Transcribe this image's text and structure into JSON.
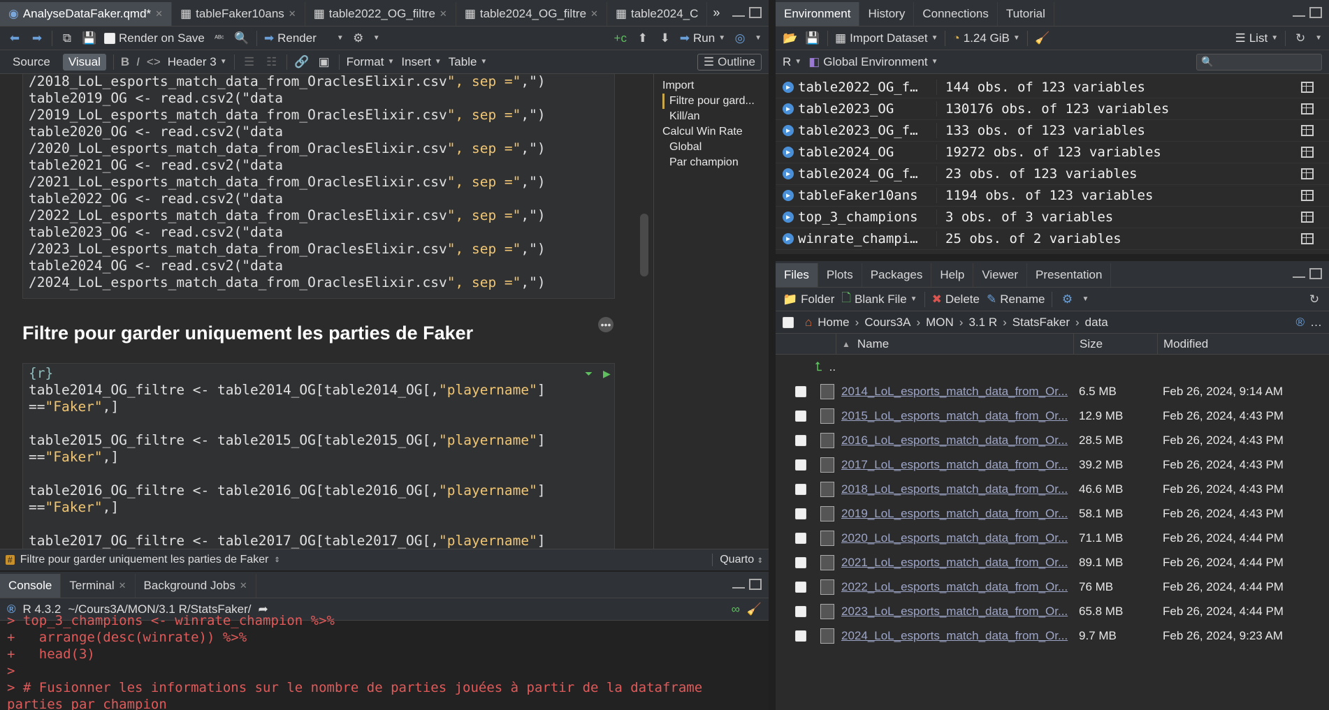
{
  "editor": {
    "tabs": [
      {
        "label": "AnalyseDataFaker.qmd*"
      },
      {
        "label": "tableFaker10ans"
      },
      {
        "label": "table2022_OG_filtre"
      },
      {
        "label": "table2024_OG_filtre"
      },
      {
        "label": "table2024_C"
      }
    ],
    "toolbar": {
      "render_on_save": "Render on Save",
      "render": "Render",
      "run": "Run"
    },
    "format_bar": {
      "source": "Source",
      "visual": "Visual",
      "bold": "B",
      "italic": "I",
      "code": "<>",
      "header": "Header 3",
      "format": "Format",
      "insert": "Insert",
      "table": "Table",
      "outline": "Outline"
    },
    "import_chunk_lines": [
      "/2018_LoL_esports_match_data_from_OraclesElixir.csv\", sep =\",\")",
      "table2019_OG <- read.csv2(\"data",
      "/2019_LoL_esports_match_data_from_OraclesElixir.csv\", sep =\",\")",
      "table2020_OG <- read.csv2(\"data",
      "/2020_LoL_esports_match_data_from_OraclesElixir.csv\", sep =\",\")",
      "table2021_OG <- read.csv2(\"data",
      "/2021_LoL_esports_match_data_from_OraclesElixir.csv\", sep =\",\")",
      "table2022_OG <- read.csv2(\"data",
      "/2022_LoL_esports_match_data_from_OraclesElixir.csv\", sep =\",\")",
      "table2023_OG <- read.csv2(\"data",
      "/2023_LoL_esports_match_data_from_OraclesElixir.csv\", sep =\",\")",
      "table2024_OG <- read.csv2(\"data",
      "/2024_LoL_esports_match_data_from_OraclesElixir.csv\", sep =\",\")"
    ],
    "heading": "Filtre pour garder uniquement les parties de Faker",
    "filter_chunk_lines": [
      "{r}",
      "table2014_OG_filtre <- table2014_OG[table2014_OG[,\"playername\"]",
      "==\"Faker\",]",
      "",
      "table2015_OG_filtre <- table2015_OG[table2015_OG[,\"playername\"]",
      "==\"Faker\",]",
      "",
      "table2016_OG_filtre <- table2016_OG[table2016_OG[,\"playername\"]",
      "==\"Faker\",]",
      "",
      "table2017_OG_filtre <- table2017_OG[table2017_OG[,\"playername\"]"
    ],
    "outline": [
      {
        "label": "Import",
        "level": 1
      },
      {
        "label": "Filtre pour gard...",
        "level": 2,
        "active": true
      },
      {
        "label": "Kill/an",
        "level": 2
      },
      {
        "label": "Calcul Win Rate",
        "level": 1
      },
      {
        "label": "Global",
        "level": 2
      },
      {
        "label": "Par champion",
        "level": 2
      }
    ],
    "status": {
      "section": "Filtre pour garder uniquement les parties de Faker",
      "doc_type": "Quarto"
    }
  },
  "console": {
    "tabs": [
      {
        "label": "Console"
      },
      {
        "label": "Terminal"
      },
      {
        "label": "Background Jobs"
      }
    ],
    "r_version": "R 4.3.2",
    "path": "~/Cours3A/MON/3.1 R/StatsFaker/",
    "lines": [
      "> top_3_champions <- winrate_champion %>%",
      "+   arrange(desc(winrate)) %>%",
      "+   head(3)",
      ">",
      "> # Fusionner les informations sur le nombre de parties jouées à partir de la dataframe",
      "parties_par_champion"
    ]
  },
  "env": {
    "tabs": [
      {
        "label": "Environment"
      },
      {
        "label": "History"
      },
      {
        "label": "Connections"
      },
      {
        "label": "Tutorial"
      }
    ],
    "toolbar": {
      "import_dataset": "Import Dataset",
      "memory": "1.24 GiB",
      "list": "List",
      "language": "R",
      "scope": "Global Environment"
    },
    "rows": [
      {
        "name": "table2022_OG_f…",
        "value": "144 obs. of 123 variables"
      },
      {
        "name": "table2023_OG",
        "value": "130176 obs. of 123 variables"
      },
      {
        "name": "table2023_OG_f…",
        "value": "133 obs. of 123 variables"
      },
      {
        "name": "table2024_OG",
        "value": "19272 obs. of 123 variables"
      },
      {
        "name": "table2024_OG_f…",
        "value": "23 obs. of 123 variables"
      },
      {
        "name": "tableFaker10ans",
        "value": "1194 obs. of 123 variables"
      },
      {
        "name": "top_3_champions",
        "value": "3 obs. of 3 variables"
      },
      {
        "name": "winrate_champi…",
        "value": "25 obs. of 2 variables"
      }
    ]
  },
  "files": {
    "tabs": [
      {
        "label": "Files"
      },
      {
        "label": "Plots"
      },
      {
        "label": "Packages"
      },
      {
        "label": "Help"
      },
      {
        "label": "Viewer"
      },
      {
        "label": "Presentation"
      }
    ],
    "toolbar": {
      "folder": "Folder",
      "blank_file": "Blank File",
      "delete": "Delete",
      "rename": "Rename"
    },
    "breadcrumbs": [
      "Home",
      "Cours3A",
      "MON",
      "3.1 R",
      "StatsFaker",
      "data"
    ],
    "columns": {
      "name": "Name",
      "size": "Size",
      "modified": "Modified"
    },
    "parent": "..",
    "rows": [
      {
        "name": "2014_LoL_esports_match_data_from_Or...",
        "size": "6.5 MB",
        "modified": "Feb 26, 2024, 9:14 AM"
      },
      {
        "name": "2015_LoL_esports_match_data_from_Or...",
        "size": "12.9 MB",
        "modified": "Feb 26, 2024, 4:43 PM"
      },
      {
        "name": "2016_LoL_esports_match_data_from_Or...",
        "size": "28.5 MB",
        "modified": "Feb 26, 2024, 4:43 PM"
      },
      {
        "name": "2017_LoL_esports_match_data_from_Or...",
        "size": "39.2 MB",
        "modified": "Feb 26, 2024, 4:43 PM"
      },
      {
        "name": "2018_LoL_esports_match_data_from_Or...",
        "size": "46.6 MB",
        "modified": "Feb 26, 2024, 4:43 PM"
      },
      {
        "name": "2019_LoL_esports_match_data_from_Or...",
        "size": "58.1 MB",
        "modified": "Feb 26, 2024, 4:43 PM"
      },
      {
        "name": "2020_LoL_esports_match_data_from_Or...",
        "size": "71.1 MB",
        "modified": "Feb 26, 2024, 4:44 PM"
      },
      {
        "name": "2021_LoL_esports_match_data_from_Or...",
        "size": "89.1 MB",
        "modified": "Feb 26, 2024, 4:44 PM"
      },
      {
        "name": "2022_LoL_esports_match_data_from_Or...",
        "size": "76 MB",
        "modified": "Feb 26, 2024, 4:44 PM"
      },
      {
        "name": "2023_LoL_esports_match_data_from_Or...",
        "size": "65.8 MB",
        "modified": "Feb 26, 2024, 4:44 PM"
      },
      {
        "name": "2024_LoL_esports_match_data_from_Or...",
        "size": "9.7 MB",
        "modified": "Feb 26, 2024, 9:23 AM"
      }
    ]
  }
}
